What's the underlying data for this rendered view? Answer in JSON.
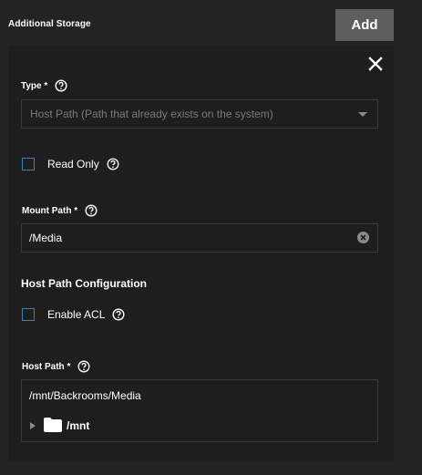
{
  "header": {
    "title": "Additional Storage",
    "add_label": "Add"
  },
  "form": {
    "type": {
      "label": "Type *",
      "value": "Host Path (Path that already exists on the system)"
    },
    "read_only": {
      "label": "Read Only",
      "checked": false
    },
    "mount_path": {
      "label": "Mount Path *",
      "value": "/Media"
    },
    "host_path_config": {
      "heading": "Host Path Configuration"
    },
    "enable_acl": {
      "label": "Enable ACL",
      "checked": false
    },
    "host_path": {
      "label": "Host Path *",
      "value": "/mnt/Backrooms/Media"
    },
    "tree": {
      "root_label": "/mnt"
    }
  },
  "colors": {
    "checkbox_border": "#3f7fb5",
    "add_button_bg": "#5e5e5e",
    "background": "#232323",
    "card_bg": "#1e1e1e"
  }
}
